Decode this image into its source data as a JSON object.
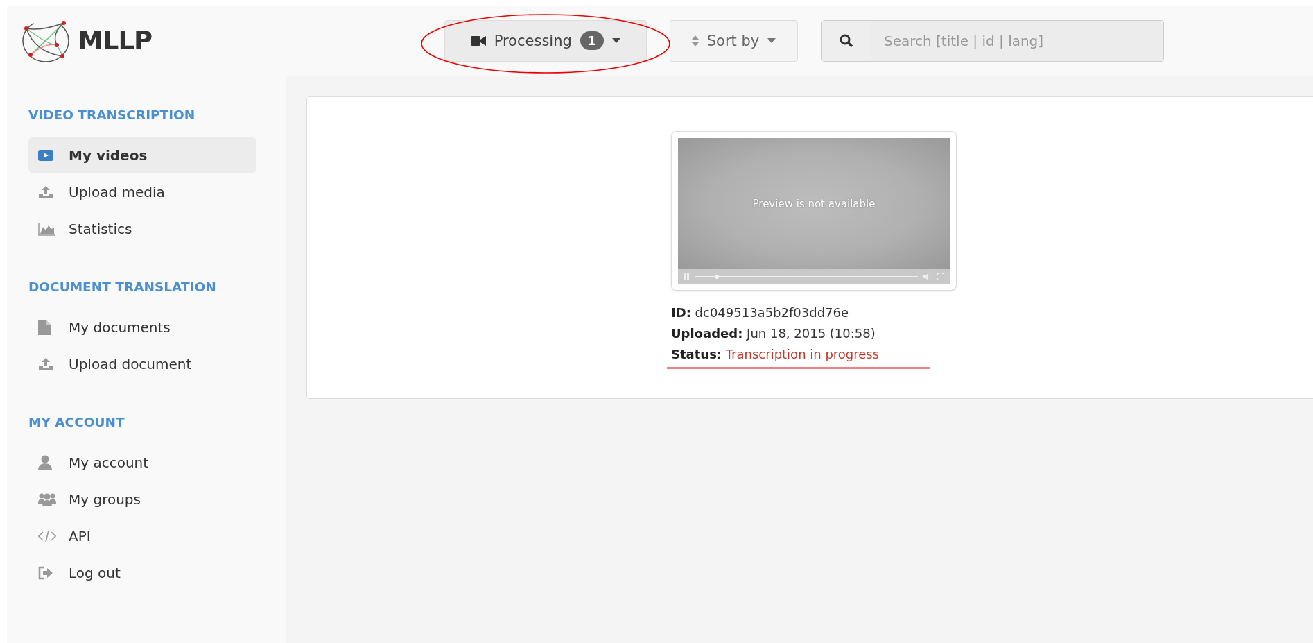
{
  "logo": {
    "text": "MLLP"
  },
  "toolbar": {
    "filter_button": {
      "label": "Processing",
      "badge": "1"
    },
    "sort_button": {
      "label": "Sort by"
    },
    "search": {
      "placeholder": "Search [title | id | lang]"
    }
  },
  "annotations": [
    {
      "kind": "ellipse"
    },
    {
      "kind": "underline"
    }
  ],
  "sidebar": {
    "sections": [
      {
        "heading": "VIDEO TRANSCRIPTION",
        "items": [
          {
            "label": "My videos",
            "selected": true
          },
          {
            "label": "Upload media",
            "selected": false
          },
          {
            "label": "Statistics",
            "selected": false
          }
        ]
      },
      {
        "heading": "DOCUMENT TRANSLATION",
        "items": [
          {
            "label": "My documents",
            "selected": false
          },
          {
            "label": "Upload document",
            "selected": false
          }
        ]
      },
      {
        "heading": "MY ACCOUNT",
        "items": [
          {
            "label": "My account",
            "selected": false
          },
          {
            "label": "My groups",
            "selected": false
          },
          {
            "label": "API",
            "selected": false
          },
          {
            "label": "Log out",
            "selected": false
          }
        ]
      }
    ]
  },
  "video": {
    "preview_message": "Preview is not available",
    "seek": {
      "level": 0.1
    },
    "details": [
      {
        "label": "ID:",
        "value": "dc049513a5b2f03dd76e",
        "kind": "plain"
      },
      {
        "label": "Uploaded:",
        "value": "Jun 18, 2015 (10:58)",
        "kind": "plain"
      },
      {
        "label": "Status:",
        "value": "Transcription in progress",
        "kind": "status"
      }
    ]
  }
}
